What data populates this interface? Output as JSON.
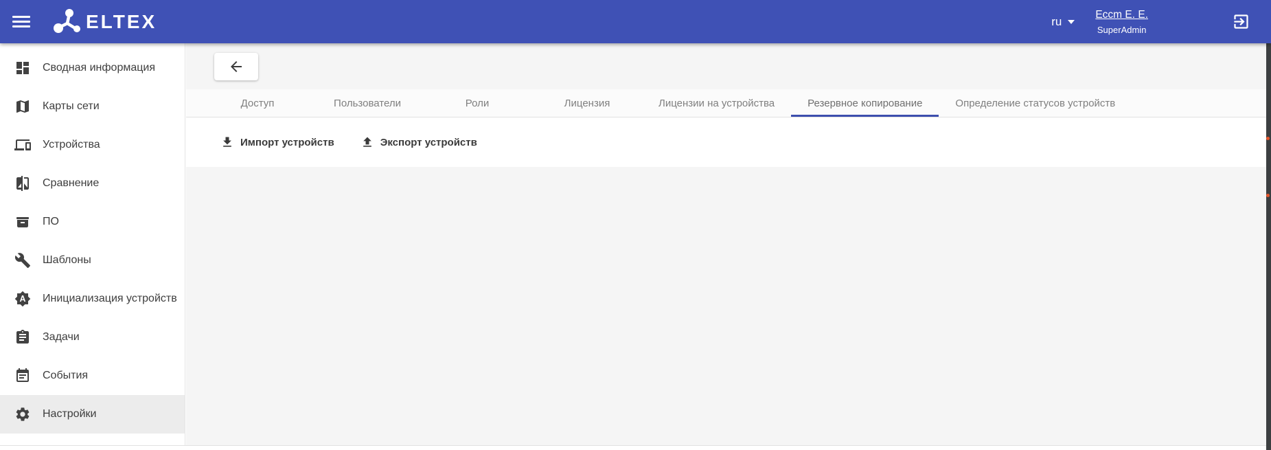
{
  "header": {
    "logo_text": "ELTEX",
    "language": {
      "code": "ru"
    },
    "user": {
      "name": "Eccm E. E.",
      "role": "SuperAdmin"
    }
  },
  "sidebar": {
    "items": [
      {
        "label": "Сводная информация",
        "icon": "dashboard-icon",
        "selected": false
      },
      {
        "label": "Карты сети",
        "icon": "map-icon",
        "selected": false
      },
      {
        "label": "Устройства",
        "icon": "devices-icon",
        "selected": false
      },
      {
        "label": "Сравнение",
        "icon": "compare-icon",
        "selected": false
      },
      {
        "label": "ПО",
        "icon": "firmware-archive-icon",
        "selected": false
      },
      {
        "label": "Шаблоны",
        "icon": "wrench-icon",
        "selected": false
      },
      {
        "label": "Инициализация устройств",
        "icon": "auto-init-icon",
        "selected": false
      },
      {
        "label": "Задачи",
        "icon": "tasks-clipboard-icon",
        "selected": false
      },
      {
        "label": "События",
        "icon": "events-calendar-icon",
        "selected": false
      },
      {
        "label": "Настройки",
        "icon": "settings-gear-icon",
        "selected": true
      }
    ],
    "selected_item": "Настройки"
  },
  "main": {
    "tabs": [
      {
        "label": "Доступ",
        "active": false
      },
      {
        "label": "Пользователи",
        "active": false
      },
      {
        "label": "Роли",
        "active": false
      },
      {
        "label": "Лицензия",
        "active": false
      },
      {
        "label": "Лицензии на устройства",
        "active": false
      },
      {
        "label": "Резервное копирование",
        "active": true
      },
      {
        "label": "Определение статусов устройств",
        "active": false
      }
    ],
    "active_tab": "Резервное копирование",
    "toolbar": {
      "import_label": "Импорт устройств",
      "export_label": "Экспорт устройств"
    }
  },
  "icons": {
    "menu": "hamburger-icon",
    "language_caret": "chevron-down-icon",
    "logout": "exit-to-app-icon",
    "back": "arrow-left-icon",
    "import": "download-icon",
    "export": "upload-icon"
  },
  "colors": {
    "header_bg": "#3f51b5",
    "active_tab_underline": "#3d4eae",
    "selected_sidebar_bg": "#ececec",
    "scroll_strip_bg": "#3c3f41",
    "scroll_marker": "#e8552b"
  }
}
